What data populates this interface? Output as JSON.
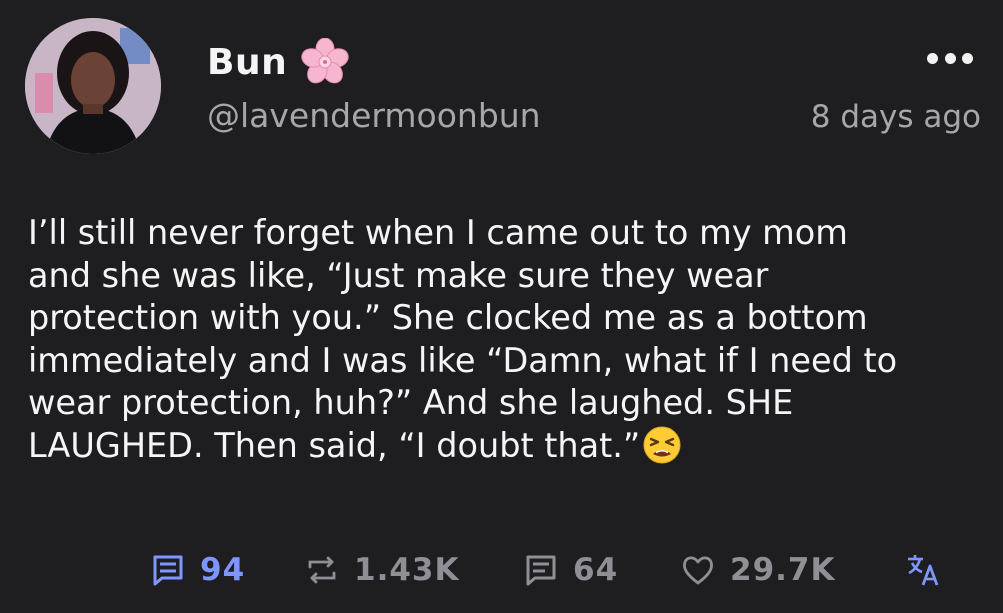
{
  "post": {
    "display_name": "Bun",
    "handle": "@lavendermoonbun",
    "timestamp": "8 days ago",
    "body": "I’ll still never forget when I came out to my mom\nand she was like, “Just make sure they wear\nprotection with you.” She clocked me as a bottom\nimmediately and I was like “Damn, what if I need to\nwear protection, huh?” And she laughed. SHE\nLAUGHED. Then said, “I doubt that.”",
    "body_emoji": "tired-face-emoji",
    "name_emoji": "cherry-blossom-icon"
  },
  "actions": {
    "replies": "94",
    "reposts": "1.43K",
    "quotes": "64",
    "likes": "29.7K"
  },
  "colors": {
    "background": "#1e1e21",
    "accent_blue": "#7f96ff",
    "muted": "#8f8f95",
    "text": "#f5f5f5"
  },
  "icons": [
    "more-options-icon",
    "reply-icon",
    "repost-icon",
    "quote-icon",
    "heart-icon",
    "translate-icon"
  ]
}
